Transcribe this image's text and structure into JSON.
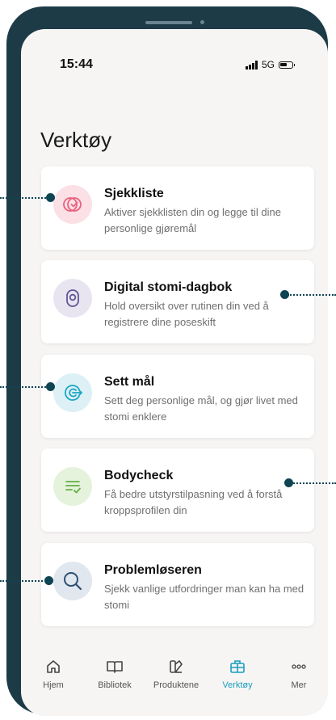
{
  "status_bar": {
    "time": "15:44",
    "network": "5G"
  },
  "page": {
    "title": "Verktøy"
  },
  "cards": [
    {
      "title": "Sjekkliste",
      "description": "Aktiver sjekklisten din og legge til dine personlige gjøremål",
      "icon": "checklist-check-icon",
      "icon_bg": "#fbe0e6",
      "icon_color": "#e8627f"
    },
    {
      "title": "Digital stomi-dagbok",
      "description": "Hold oversikt over rutinen din ved å registrere dine poseskift",
      "icon": "stoma-pouch-icon",
      "icon_bg": "#e8e5f1",
      "icon_color": "#5f5594"
    },
    {
      "title": "Sett mål",
      "description": "Sett deg personlige mål, og gjør livet med stomi enklere",
      "icon": "target-goal-icon",
      "icon_bg": "#dcf0f5",
      "icon_color": "#1aa7c4"
    },
    {
      "title": "Bodycheck",
      "description": "Få bedre utstyrstilpasning ved å forstå kroppsprofilen din",
      "icon": "list-check-icon",
      "icon_bg": "#e5f2dc",
      "icon_color": "#65b042"
    },
    {
      "title": "Problemløseren",
      "description": "Sjekk vanlige utfordringer man kan ha med stomi",
      "icon": "magnifier-icon",
      "icon_bg": "#e1e7ef",
      "icon_color": "#2e4f72"
    }
  ],
  "tabs": [
    {
      "label": "Hjem",
      "icon": "home-icon"
    },
    {
      "label": "Bibliotek",
      "icon": "book-icon"
    },
    {
      "label": "Produktene",
      "icon": "products-icon"
    },
    {
      "label": "Verktøy",
      "icon": "toolbox-icon",
      "active": true
    },
    {
      "label": "Mer",
      "icon": "more-dots-icon"
    }
  ],
  "colors": {
    "accent": "#1a9fbf",
    "frame": "#1d3b47",
    "pointer": "#0f4452"
  }
}
